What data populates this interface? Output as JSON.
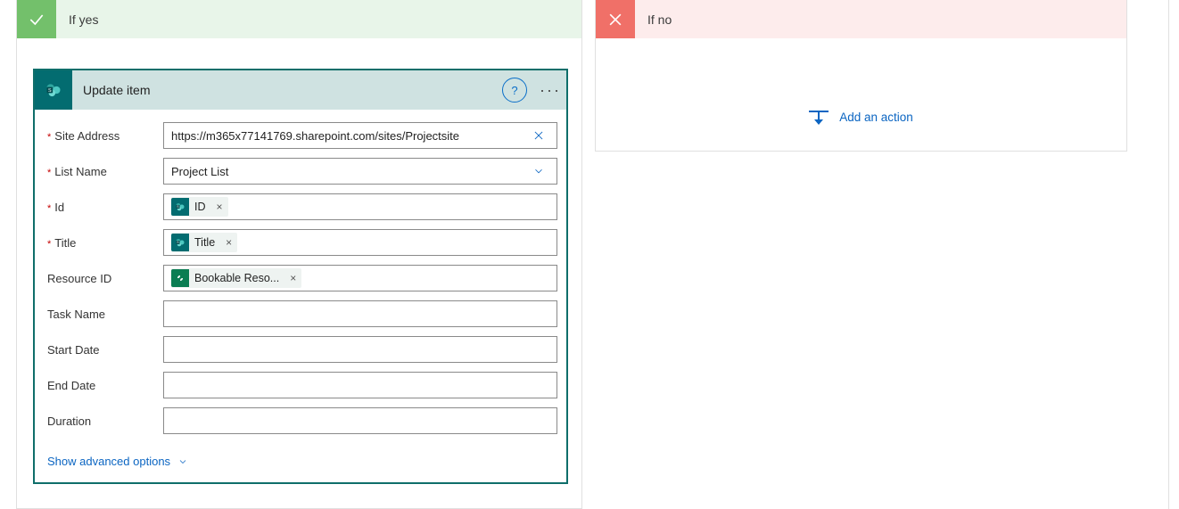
{
  "branches": {
    "yes": {
      "label": "If yes"
    },
    "no": {
      "label": "If no",
      "add_action_label": "Add an action"
    }
  },
  "action": {
    "title": "Update item",
    "help_glyph": "?",
    "advanced_link": "Show advanced options",
    "fields": {
      "site_address": {
        "label": "Site Address",
        "required": true,
        "value": "https://m365x77141769.sharepoint.com/sites/Projectsite"
      },
      "list_name": {
        "label": "List Name",
        "required": true,
        "value": "Project List"
      },
      "id": {
        "label": "Id",
        "required": true,
        "token": {
          "source": "sp",
          "text": "ID"
        }
      },
      "title": {
        "label": "Title",
        "required": true,
        "token": {
          "source": "sp",
          "text": "Title"
        }
      },
      "resource_id": {
        "label": "Resource ID",
        "required": false,
        "token": {
          "source": "cds",
          "text": "Bookable Reso..."
        }
      },
      "task_name": {
        "label": "Task Name",
        "required": false
      },
      "start_date": {
        "label": "Start Date",
        "required": false
      },
      "end_date": {
        "label": "End Date",
        "required": false
      },
      "duration": {
        "label": "Duration",
        "required": false
      }
    }
  }
}
